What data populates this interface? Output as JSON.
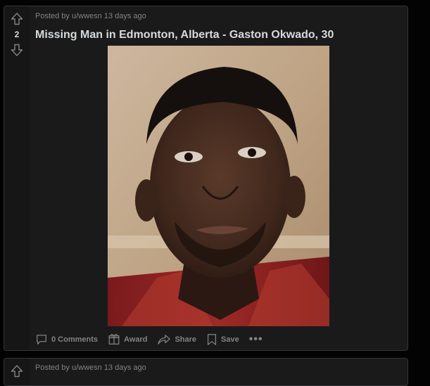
{
  "post": {
    "votes": "2",
    "meta": "Posted by u/wwesn 13 days ago",
    "title": "Missing Man in Edmonton, Alberta - Gaston Okwado, 30",
    "actions": {
      "comments": "0 Comments",
      "award": "Award",
      "share": "Share",
      "save": "Save",
      "more": "•••"
    }
  },
  "next_post": {
    "meta": "Posted by u/wwesn 13 days ago"
  },
  "colors": {
    "background": "#030303",
    "card": "#1a1a1b",
    "border": "#343536",
    "text_primary": "#d7dadc",
    "text_muted": "#818384"
  },
  "icons": [
    "upvote-arrow-icon",
    "downvote-arrow-icon",
    "comment-icon",
    "award-icon",
    "share-icon",
    "save-bookmark-icon",
    "more-options-icon"
  ]
}
